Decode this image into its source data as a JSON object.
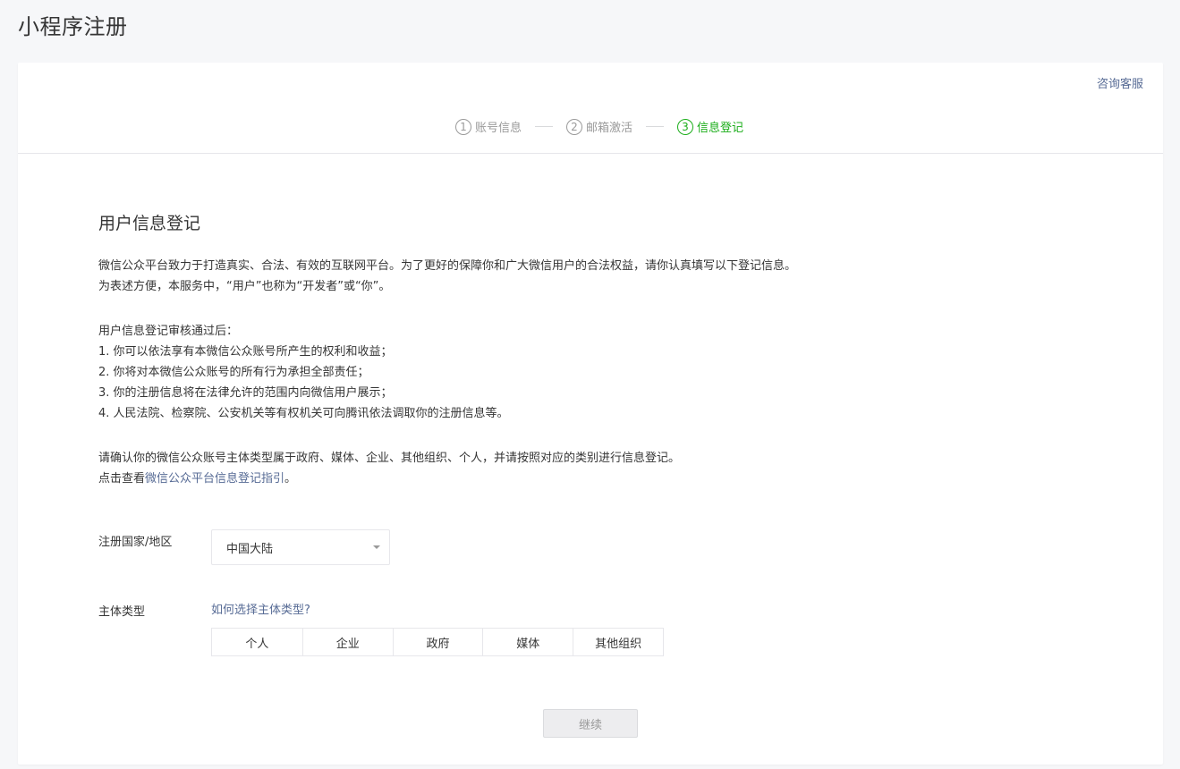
{
  "page": {
    "title": "小程序注册"
  },
  "header": {
    "consult_label": "咨询客服"
  },
  "steps": [
    {
      "num": "1",
      "label": "账号信息",
      "active": false
    },
    {
      "num": "2",
      "label": "邮箱激活",
      "active": false
    },
    {
      "num": "3",
      "label": "信息登记",
      "active": true
    }
  ],
  "main": {
    "title": "用户信息登记",
    "intro": [
      "微信公众平台致力于打造真实、合法、有效的互联网平台。为了更好的保障你和广大微信用户的合法权益，请你认真填写以下登记信息。",
      "为表述方便，本服务中，“用户”也称为“开发者”或“你”。"
    ],
    "rules": [
      "用户信息登记审核通过后：",
      "1. 你可以依法享有本微信公众账号所产生的权利和收益；",
      "2. 你将对本微信公众账号的所有行为承担全部责任；",
      "3. 你的注册信息将在法律允许的范围内向微信用户展示；",
      "4. 人民法院、检察院、公安机关等有权机关可向腾讯依法调取你的注册信息等。"
    ],
    "confirm": "请确认你的微信公众账号主体类型属于政府、媒体、企业、其他组织、个人，并请按照对应的类别进行信息登记。",
    "guide_prefix": "点击查看",
    "guide_link": "微信公众平台信息登记指引",
    "guide_suffix": "。"
  },
  "form": {
    "country_label": "注册国家/地区",
    "country_value": "中国大陆",
    "type_label": "主体类型",
    "type_help": "如何选择主体类型?",
    "types": [
      "个人",
      "企业",
      "政府",
      "媒体",
      "其他组织"
    ]
  },
  "actions": {
    "continue_label": "继续"
  }
}
